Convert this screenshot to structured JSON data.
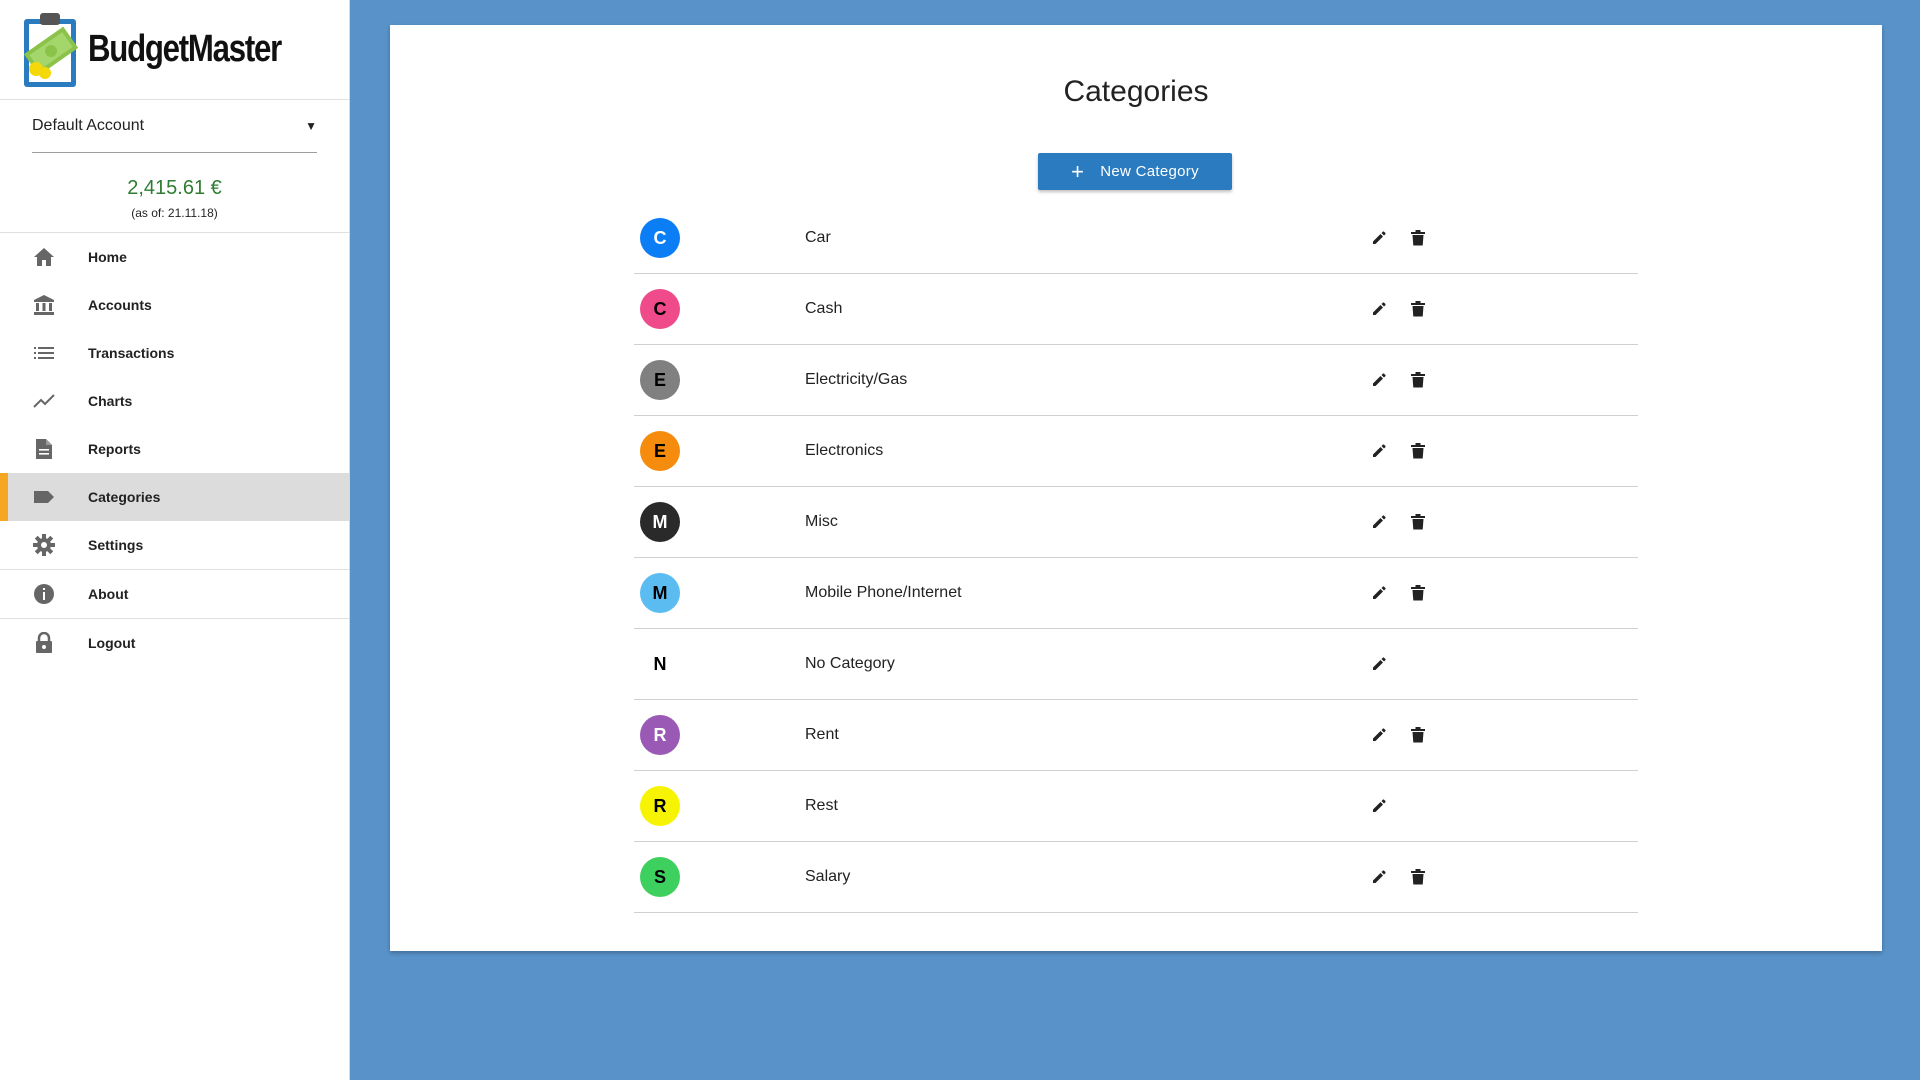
{
  "app": {
    "name": "BudgetMaster"
  },
  "account": {
    "selected": "Default Account",
    "balance": "2,415.61 €",
    "as_of": "(as of: 21.11.18)"
  },
  "nav": [
    {
      "label": "Home",
      "icon": "home-icon"
    },
    {
      "label": "Accounts",
      "icon": "bank-icon"
    },
    {
      "label": "Transactions",
      "icon": "list-icon"
    },
    {
      "label": "Charts",
      "icon": "chart-line-icon"
    },
    {
      "label": "Reports",
      "icon": "document-icon"
    },
    {
      "label": "Categories",
      "icon": "label-icon",
      "active": true
    },
    {
      "label": "Settings",
      "icon": "gear-icon"
    },
    {
      "label": "About",
      "icon": "info-icon"
    },
    {
      "label": "Logout",
      "icon": "lock-icon"
    }
  ],
  "page": {
    "title": "Categories",
    "new_button": "New Category"
  },
  "categories": [
    {
      "initial": "C",
      "name": "Car",
      "color": "#0b7ef5",
      "text_color": "#ffffff",
      "deletable": true
    },
    {
      "initial": "C",
      "name": "Cash",
      "color": "#ef4a8a",
      "text_color": "#000000",
      "deletable": true
    },
    {
      "initial": "E",
      "name": "Electricity/Gas",
      "color": "#808080",
      "text_color": "#000000",
      "deletable": true
    },
    {
      "initial": "E",
      "name": "Electronics",
      "color": "#f68c0d",
      "text_color": "#000000",
      "deletable": true
    },
    {
      "initial": "M",
      "name": "Misc",
      "color": "#2a2a2a",
      "text_color": "#ffffff",
      "deletable": true
    },
    {
      "initial": "M",
      "name": "Mobile Phone/Internet",
      "color": "#5bbcf2",
      "text_color": "#000000",
      "deletable": true
    },
    {
      "initial": "N",
      "name": "No Category",
      "color": "#ffffff",
      "text_color": "#000000",
      "deletable": false
    },
    {
      "initial": "R",
      "name": "Rent",
      "color": "#9b59b6",
      "text_color": "#ffffff",
      "deletable": true
    },
    {
      "initial": "R",
      "name": "Rest",
      "color": "#f7f403",
      "text_color": "#000000",
      "deletable": false
    },
    {
      "initial": "S",
      "name": "Salary",
      "color": "#3ed05e",
      "text_color": "#000000",
      "deletable": true
    }
  ],
  "colors": {
    "background": "#5892c8",
    "accent": "#2b7bc0",
    "active_marker": "#f5a623",
    "balance": "#2e7d32"
  }
}
